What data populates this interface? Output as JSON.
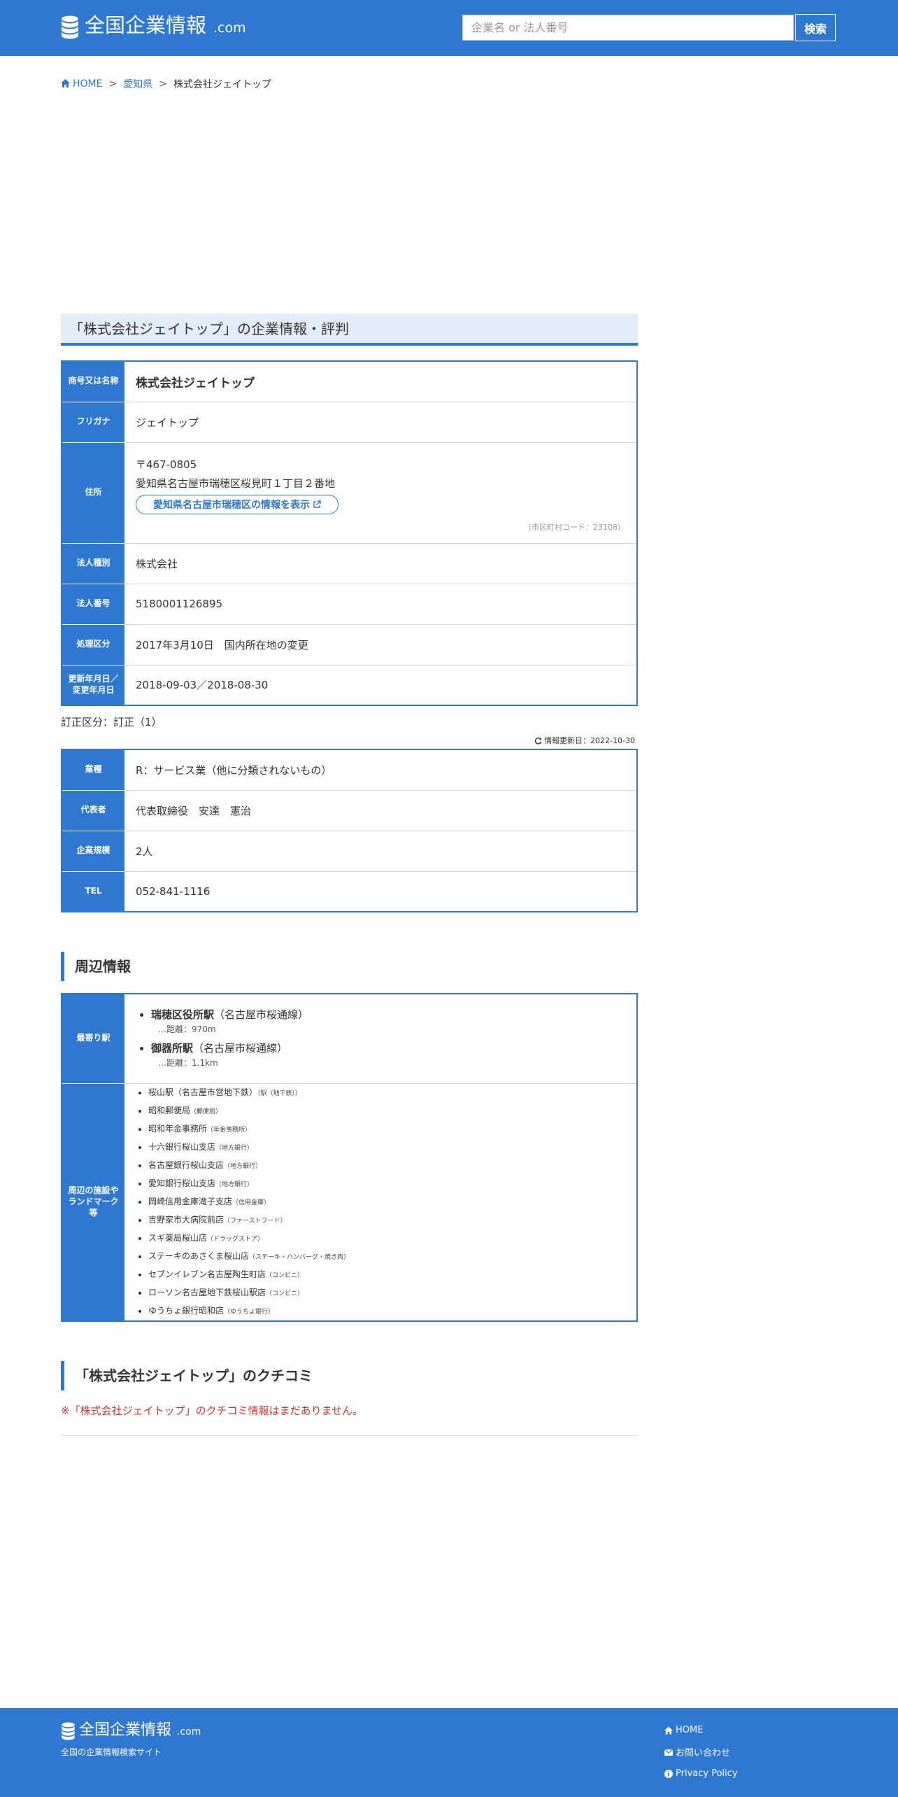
{
  "header": {
    "logo_text": "全国企業情報",
    "logo_com": ".com",
    "search_placeholder": "企業名 or 法人番号",
    "search_button": "検索"
  },
  "breadcrumb": {
    "home": "HOME",
    "pref": "愛知県",
    "current": "株式会社ジェイトップ",
    "separator": ">"
  },
  "page_title": "「株式会社ジェイトップ」の企業情報・評判",
  "basic_info": {
    "name_label": "商号又は名称",
    "name_value": "株式会社ジェイトップ",
    "furigana_label": "フリガナ",
    "furigana_value": "ジェイトップ",
    "address_label": "住所",
    "postal": "〒467-0805",
    "address": "愛知県名古屋市瑞穂区桜見町１丁目２番地",
    "area_link": "愛知県名古屋市瑞穂区の情報を表示",
    "city_code": "（市区町村コード：23108）",
    "type_label": "法人種別",
    "type_value": "株式会社",
    "number_label": "法人番号",
    "number_value": "5180001126895",
    "process_label": "処理区分",
    "process_value": "2017年3月10日　国内所在地の変更",
    "update_label_1": "更新年月日／",
    "update_label_2": "変更年月日",
    "update_value": "2018-09-03／2018-08-30"
  },
  "correction": "訂正区分：訂正（1）",
  "info_updated": "情報更新日：2022-10-30",
  "detail_info": {
    "industry_label": "業種",
    "industry_value": "R：サービス業（他に分類されないもの）",
    "rep_label": "代表者",
    "rep_value": "代表取締役　安達　憲治",
    "size_label": "企業規模",
    "size_value": "2人",
    "tel_label": "TEL",
    "tel_value": "052-841-1116"
  },
  "nearby": {
    "heading": "周辺情報",
    "station_label": "最寄り駅",
    "stations": [
      {
        "name": "瑞穂区役所駅",
        "line": "（名古屋市桜通線）",
        "distance": "…距離：970m"
      },
      {
        "name": "御器所駅",
        "line": "（名古屋市桜通線）",
        "distance": "…距離：1.1km"
      }
    ],
    "facilities_label_1": "周辺の施設や",
    "facilities_label_2": "ランドマーク",
    "facilities_label_3": "等",
    "facilities": [
      {
        "name": "桜山駅（名古屋市営地下鉄）",
        "tag": "（駅（地下鉄））"
      },
      {
        "name": "昭和郵便局",
        "tag": "（郵便局）"
      },
      {
        "name": "昭和年金事務所",
        "tag": "（年金事務所）"
      },
      {
        "name": "十六銀行桜山支店",
        "tag": "（地方銀行）"
      },
      {
        "name": "名古屋銀行桜山支店",
        "tag": "（地方銀行）"
      },
      {
        "name": "愛知銀行桜山支店",
        "tag": "（地方銀行）"
      },
      {
        "name": "岡崎信用金庫滝子支店",
        "tag": "（信用金庫）"
      },
      {
        "name": "吉野家市大病院前店",
        "tag": "（ファーストフード）"
      },
      {
        "name": "スギ薬局桜山店",
        "tag": "（ドラッグストア）"
      },
      {
        "name": "ステーキのあさくま桜山店",
        "tag": "（ステーキ・ハンバーグ・焼き肉）"
      },
      {
        "name": "セブンイレブン名古屋陶生町店",
        "tag": "（コンビニ）"
      },
      {
        "name": "ローソン名古屋地下鉄桜山駅店",
        "tag": "（コンビニ）"
      },
      {
        "name": "ゆうちょ銀行昭和店",
        "tag": "（ゆうちょ銀行）"
      }
    ]
  },
  "reviews": {
    "heading": "「株式会社ジェイトップ」のクチコミ",
    "empty": "※「株式会社ジェイトップ」のクチコミ情報はまだありません。"
  },
  "footer": {
    "logo_text": "全国企業情報",
    "logo_com": ".com",
    "tagline": "全国の企業情報検索サイト",
    "home": "HOME",
    "contact": "お問い合わせ",
    "privacy": "Privacy Policy"
  },
  "colors": {
    "primary": "#2e78d2",
    "title_bg": "#e3edf9",
    "warning": "#d9322d"
  },
  "icons": [
    "database-icon",
    "home-icon",
    "external-link-icon",
    "refresh-icon",
    "envelope-icon",
    "info-circle-icon"
  ]
}
